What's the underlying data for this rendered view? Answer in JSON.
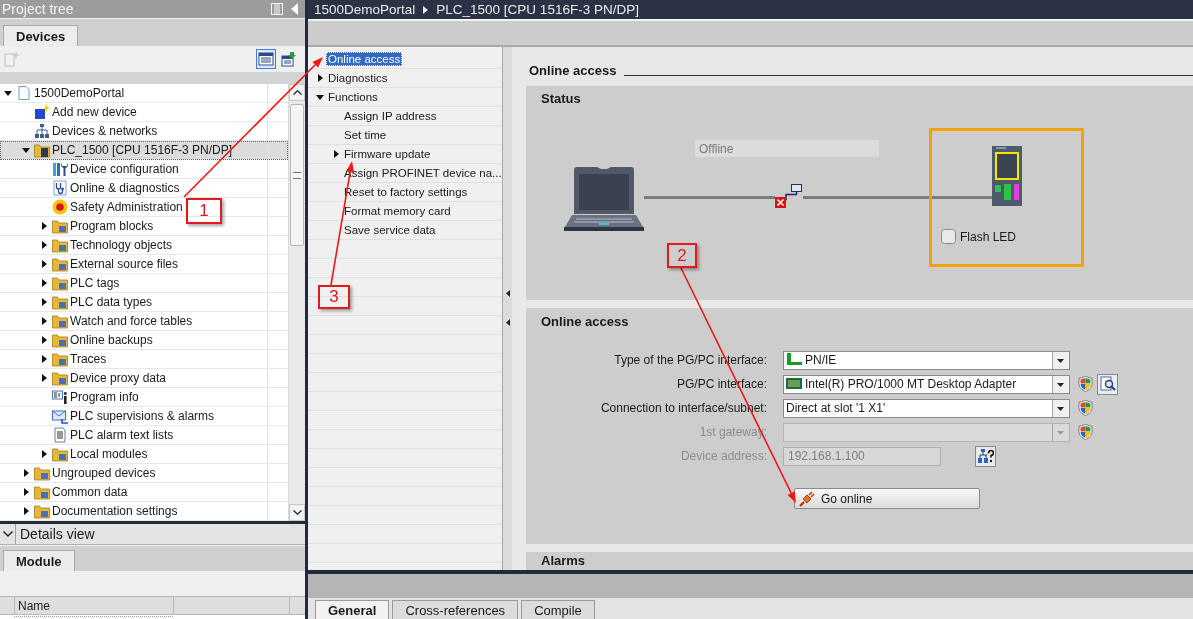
{
  "project_tree": {
    "title": "Project tree",
    "tabs": [
      {
        "label": "Devices",
        "selected": true
      }
    ],
    "toolbar": [
      {
        "kind": "new",
        "disabled": true,
        "selected": false
      },
      {
        "kind": "details",
        "disabled": false,
        "selected": true
      },
      {
        "kind": "refresh",
        "disabled": false,
        "selected": false
      }
    ],
    "items": [
      {
        "label": "1500DemoPortal",
        "kind": "project",
        "expandable": true,
        "expanded": true,
        "selected": false,
        "children": [
          {
            "label": "Add new device",
            "kind": "add",
            "expandable": false,
            "expanded": false,
            "selected": false
          },
          {
            "label": "Devices & networks",
            "kind": "network",
            "expandable": false,
            "expanded": false,
            "selected": false
          },
          {
            "label": "PLC_1500 [CPU 1516F-3 PN/DP]",
            "kind": "plc",
            "expandable": true,
            "expanded": true,
            "selected": true,
            "children": [
              {
                "label": "Device configuration",
                "kind": "config",
                "expandable": false,
                "expanded": false,
                "selected": false
              },
              {
                "label": "Online & diagnostics",
                "kind": "diagnostics",
                "expandable": false,
                "expanded": false,
                "selected": false
              },
              {
                "label": "Safety Administration",
                "kind": "safety",
                "expandable": false,
                "expanded": false,
                "selected": false
              },
              {
                "label": "Program blocks",
                "kind": "folder",
                "expandable": true,
                "expanded": false,
                "selected": false
              },
              {
                "label": "Technology objects",
                "kind": "folder",
                "expandable": true,
                "expanded": false,
                "selected": false
              },
              {
                "label": "External source files",
                "kind": "folder",
                "expandable": true,
                "expanded": false,
                "selected": false
              },
              {
                "label": "PLC tags",
                "kind": "folder",
                "expandable": true,
                "expanded": false,
                "selected": false
              },
              {
                "label": "PLC data types",
                "kind": "folder",
                "expandable": true,
                "expanded": false,
                "selected": false
              },
              {
                "label": "Watch and force tables",
                "kind": "folder",
                "expandable": true,
                "expanded": false,
                "selected": false
              },
              {
                "label": "Online backups",
                "kind": "folder",
                "expandable": true,
                "expanded": false,
                "selected": false
              },
              {
                "label": "Traces",
                "kind": "folder",
                "expandable": true,
                "expanded": false,
                "selected": false
              },
              {
                "label": "Device proxy data",
                "kind": "folder",
                "expandable": true,
                "expanded": false,
                "selected": false
              },
              {
                "label": "Program info",
                "kind": "info",
                "expandable": false,
                "expanded": false,
                "selected": false
              },
              {
                "label": "PLC supervisions & alarms",
                "kind": "alarms",
                "expandable": false,
                "expanded": false,
                "selected": false
              },
              {
                "label": "PLC alarm text lists",
                "kind": "textlist",
                "expandable": false,
                "expanded": false,
                "selected": false
              },
              {
                "label": "Local modules",
                "kind": "folder",
                "expandable": true,
                "expanded": false,
                "selected": false
              }
            ]
          },
          {
            "label": "Ungrouped devices",
            "kind": "folder",
            "expandable": true,
            "expanded": false,
            "selected": false
          },
          {
            "label": "Common data",
            "kind": "folder",
            "expandable": true,
            "expanded": false,
            "selected": false
          },
          {
            "label": "Documentation settings",
            "kind": "folder",
            "expandable": true,
            "expanded": false,
            "selected": false
          }
        ]
      }
    ]
  },
  "details_view": {
    "title": "Details view",
    "tabs": [
      {
        "label": "Module",
        "selected": true
      }
    ],
    "columns": [
      "Name"
    ]
  },
  "breadcrumb": [
    "1500DemoPortal",
    "PLC_1500 [CPU 1516F-3 PN/DP]"
  ],
  "navigation": [
    {
      "label": "Online access",
      "expandable": false,
      "expanded": false,
      "selected": true
    },
    {
      "label": "Diagnostics",
      "expandable": true,
      "expanded": false,
      "selected": false
    },
    {
      "label": "Functions",
      "expandable": true,
      "expanded": true,
      "selected": false,
      "children": [
        {
          "label": "Assign IP address",
          "expandable": false,
          "expanded": false,
          "selected": false
        },
        {
          "label": "Set time",
          "expandable": false,
          "expanded": false,
          "selected": false
        },
        {
          "label": "Firmware update",
          "expandable": true,
          "expanded": false,
          "selected": false
        },
        {
          "label": "Assign PROFINET device na...",
          "expandable": false,
          "expanded": false,
          "selected": false
        },
        {
          "label": "Reset to factory settings",
          "expandable": false,
          "expanded": false,
          "selected": false
        },
        {
          "label": "Format memory card",
          "expandable": false,
          "expanded": false,
          "selected": false
        },
        {
          "label": "Save service data",
          "expandable": false,
          "expanded": false,
          "selected": false
        }
      ]
    }
  ],
  "content": {
    "heading": "Online access",
    "status": {
      "title": "Status",
      "state": "Offline",
      "flash_led": {
        "label": "Flash LED",
        "checked": false
      }
    },
    "online_access": {
      "title": "Online access",
      "fields": [
        {
          "label": "Type of the PG/PC interface:",
          "value": "PN/IE",
          "kind": "dropdown",
          "disabled": false
        },
        {
          "label": "PG/PC interface:",
          "value": "Intel(R) PRO/1000 MT Desktop Adapter",
          "kind": "dropdown",
          "disabled": false
        },
        {
          "label": "Connection to interface/subnet:",
          "value": "Direct at slot '1 X1'",
          "kind": "dropdown",
          "disabled": false
        },
        {
          "label": "1st gateway:",
          "kind": "dropdown",
          "disabled": true
        },
        {
          "label": "Device address:",
          "value": "192.168.1.100",
          "kind": "text",
          "disabled": true
        }
      ],
      "button": "Go online"
    },
    "alarms": {
      "title": "Alarms"
    }
  },
  "inspector_tabs": [
    {
      "label": "General",
      "selected": true
    },
    {
      "label": "Cross-references",
      "selected": false
    },
    {
      "label": "Compile",
      "selected": false
    }
  ],
  "annotations": [
    {
      "number": "1"
    },
    {
      "number": "2"
    },
    {
      "number": "3"
    }
  ]
}
